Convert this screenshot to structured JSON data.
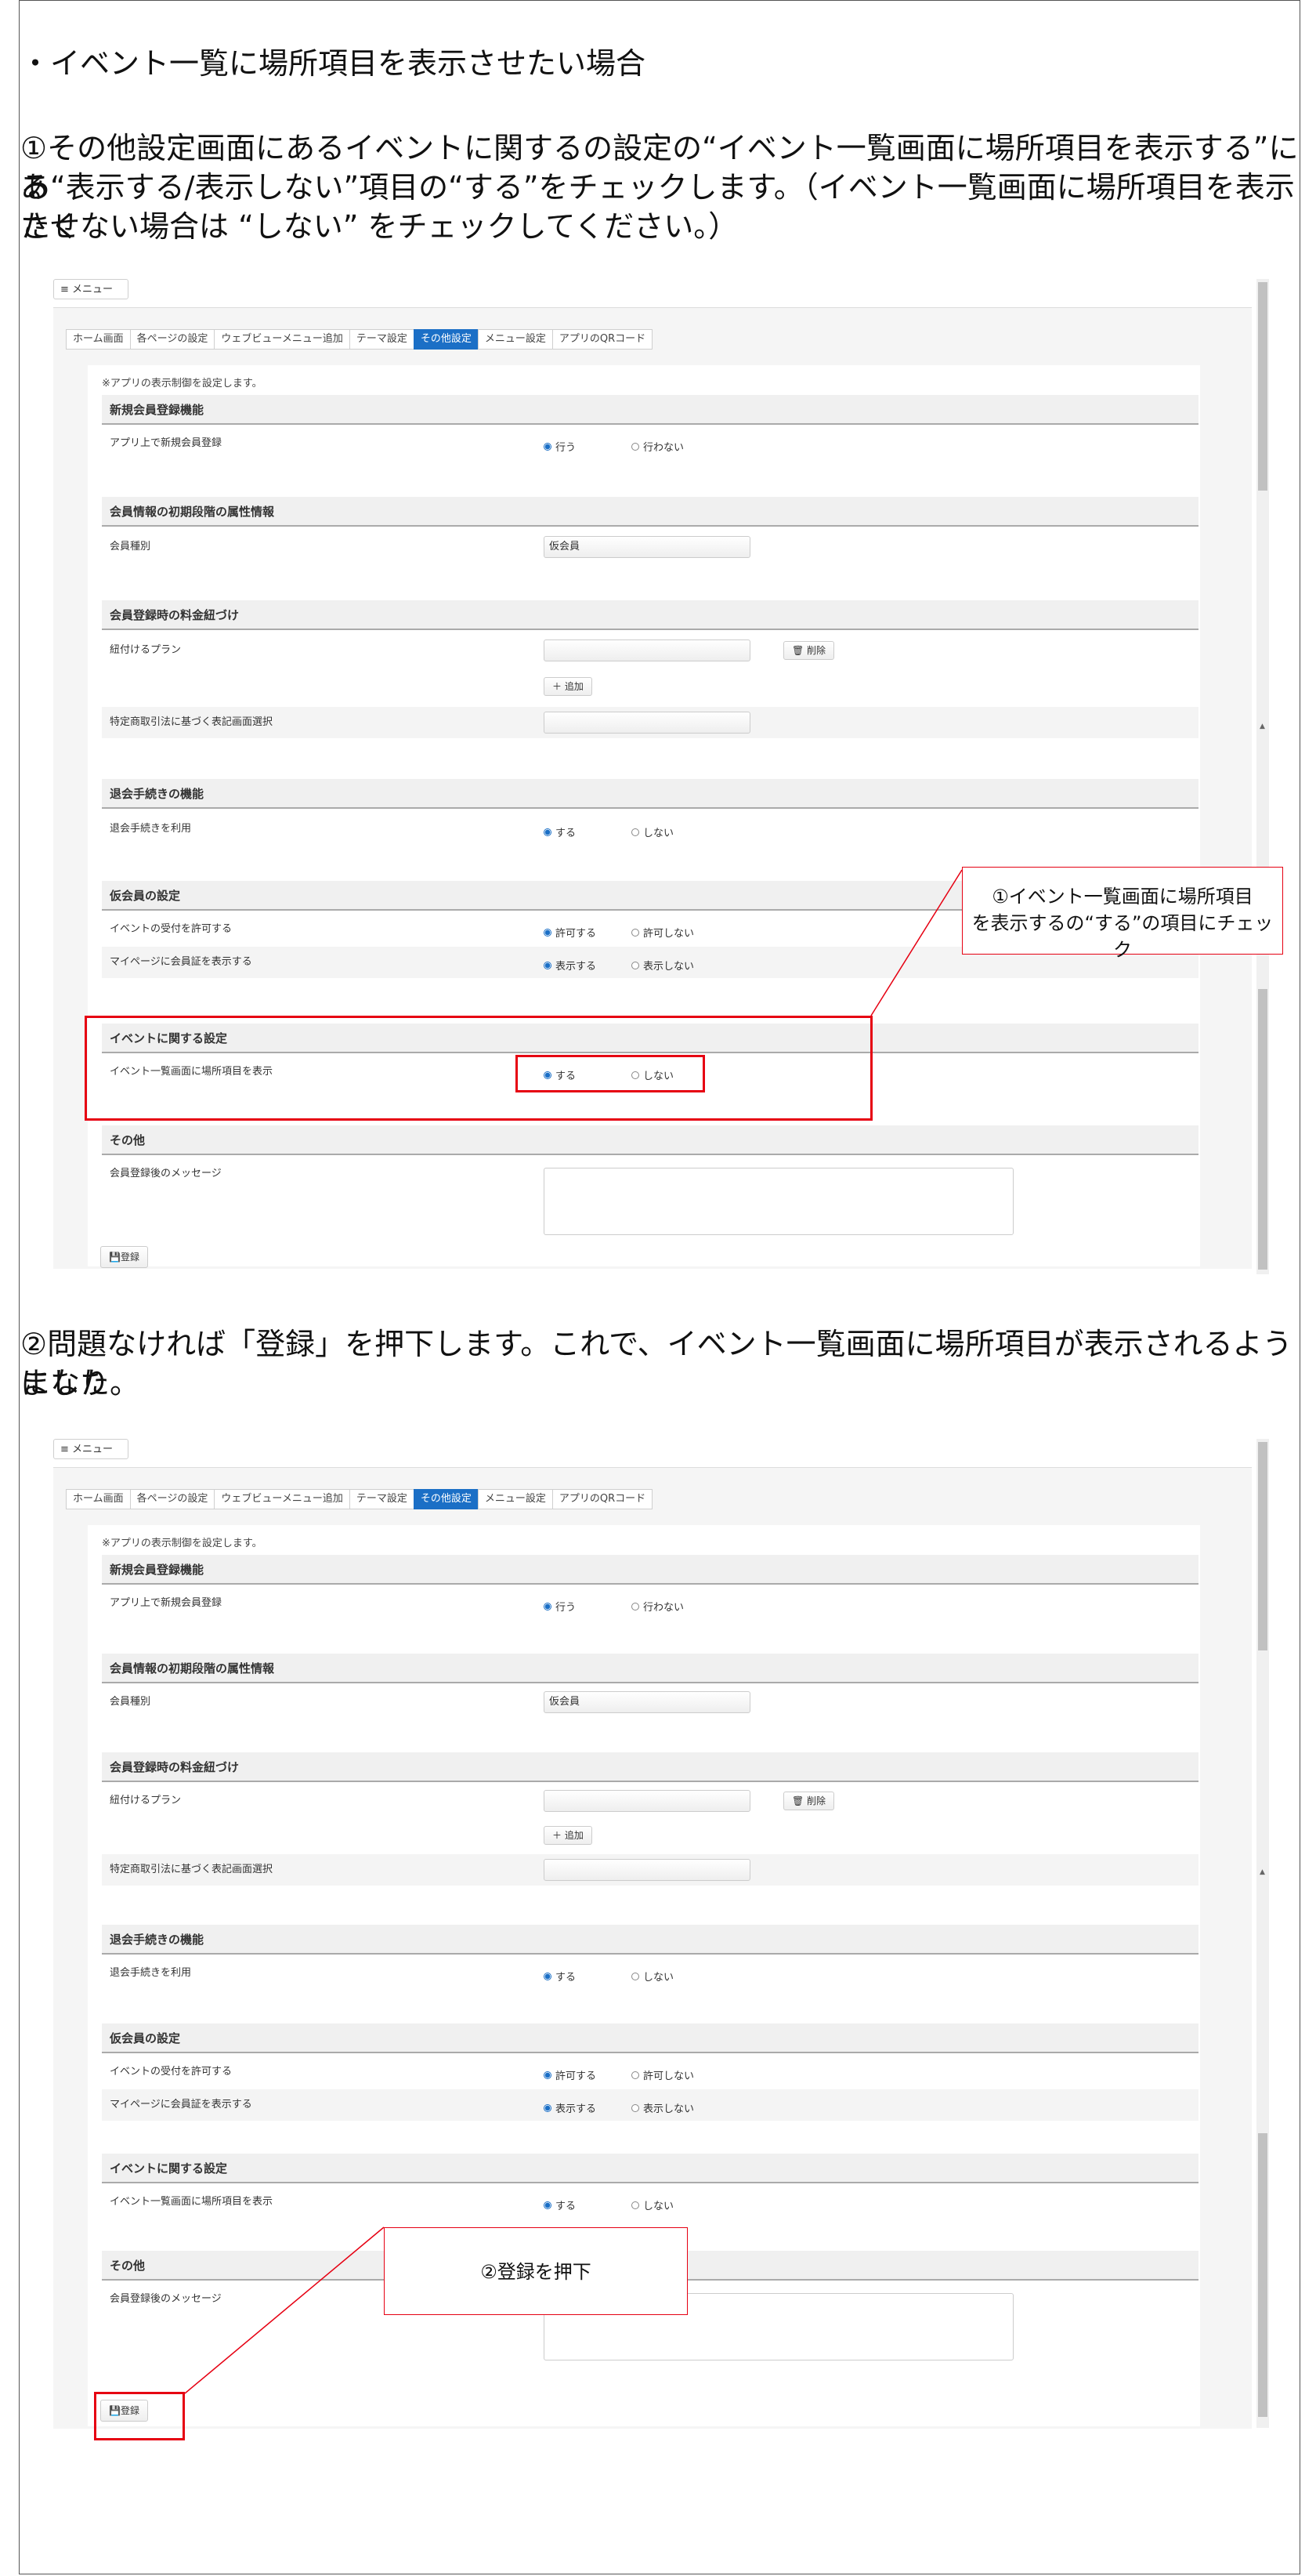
{
  "instructions": {
    "title": "・イベント一覧に場所項目を表示させたい場合",
    "step1_line1": "①その他設定画面にあるイベントに関するの設定の“イベント一覧画面に場所項目を表示する”にあ",
    "step1_line2": "る“表示する/表示しない”項目の“する”をチェックします。（イベント一覧画面に場所項目を表示させ",
    "step1_line3": "たくない場合は “しない” をチェックしてください。）",
    "step2_line1": "②問題なければ「登録」を押下します。これで、イベント一覧画面に場所項目が表示されるようになり",
    "step2_line2": "ました。"
  },
  "app": {
    "menu_label": "≡ メニュー",
    "tabs": [
      "ホーム画面",
      "各ページの設定",
      "ウェブビューメニュー追加",
      "テーマ設定",
      "その他設定",
      "メニュー設定",
      "アプリのQRコード"
    ],
    "active_tab": "その他設定",
    "note": "※アプリの表示制御を設定します。",
    "sections": {
      "new_member": "新規会員登録機能",
      "attributes": "会員情報の初期段階の属性情報",
      "pricing": "会員登録時の料金紐づけ",
      "withdrawal": "退会手続きの機能",
      "provisional": "仮会員の設定",
      "event": "イベントに関する設定",
      "other": "その他"
    },
    "rows": {
      "app_register": "アプリ上で新規会員登録",
      "member_type": "会員種別",
      "link_plan": "紐付けるプラン",
      "commerce_law": "特定商取引法に基づく表記画面選択",
      "withdraw_use": "退会手続きを利用",
      "event_accept": "イベントの受付を許可する",
      "mypage_card": "マイページに会員証を表示する",
      "event_location": "イベント一覧画面に場所項目を表示",
      "post_message": "会員登録後のメッセージ"
    },
    "options": {
      "do": "行う",
      "dont_do": "行わない",
      "yes": "する",
      "no": "しない",
      "allow": "許可する",
      "disallow": "許可しない",
      "show": "表示する",
      "hide": "表示しない"
    },
    "member_type_value": "仮会員",
    "delete_label": "🗑 削除",
    "add_label": "＋ 追加",
    "register_label": "💾登録"
  },
  "callouts": {
    "step1": [
      "①イベント一覧画面に場所項目",
      "を表示するの“する”の項目にチェック"
    ],
    "step2": "②登録を押下"
  },
  "colors": {
    "annotation_red": "#e60012",
    "active_tab_blue": "#1b6fc6"
  }
}
